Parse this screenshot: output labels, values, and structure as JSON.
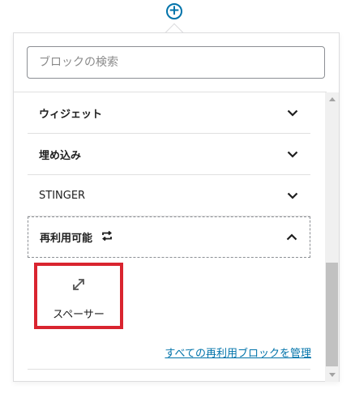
{
  "inserter": {
    "add_button_glyph": "+",
    "search": {
      "placeholder": "ブロックの検索",
      "value": ""
    },
    "panels": [
      {
        "label": "ウィジェット",
        "expanded": false
      },
      {
        "label": "埋め込み",
        "expanded": false
      },
      {
        "label": "STINGER",
        "expanded": false
      },
      {
        "label": "再利用可能",
        "expanded": true,
        "icon": "reusable-icon"
      }
    ],
    "reusable_block": {
      "label": "スペーサー",
      "icon": "resize-arrows-icon",
      "highlighted": true,
      "highlight_color": "#d9242f"
    },
    "manage_link": "すべての再利用ブロックを管理"
  },
  "colors": {
    "accent": "#0073aa",
    "highlight": "#d9242f"
  }
}
